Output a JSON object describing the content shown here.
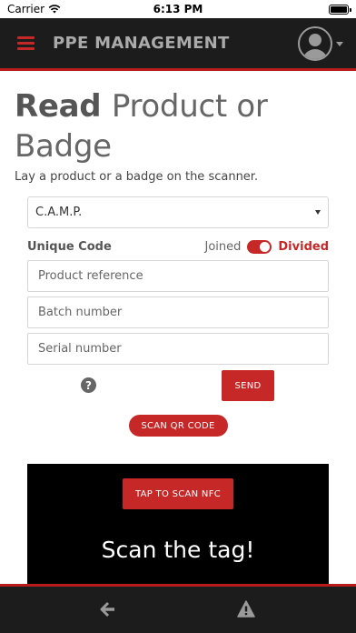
{
  "status_bar": {
    "carrier": "Carrier",
    "time": "6:13 PM"
  },
  "header": {
    "title": "PPE MANAGEMENT"
  },
  "page": {
    "title_strong": "Read",
    "title_rest": "Product or Badge",
    "subtitle": "Lay a product or a badge on the scanner."
  },
  "form": {
    "brand_select": "C.A.M.P.",
    "unique_code_label": "Unique Code",
    "toggle_off_label": "Joined",
    "toggle_on_label": "Divided",
    "product_reference_placeholder": "Product reference",
    "batch_number_placeholder": "Batch number",
    "serial_number_placeholder": "Serial number",
    "help_glyph": "?",
    "send_label": "SEND"
  },
  "scan_qr_label": "SCAN QR CODE",
  "nfc": {
    "button_label": "TAP TO SCAN NFC",
    "prompt": "Scan the tag!"
  },
  "colors": {
    "accent": "#c62828",
    "header_bg": "#1c1c1c",
    "panel_bg": "#000000"
  },
  "icons": {
    "menu": "hamburger-icon",
    "user": "user-avatar-icon",
    "back": "arrow-left-icon",
    "warning": "warning-icon",
    "help": "help-circle-icon"
  }
}
